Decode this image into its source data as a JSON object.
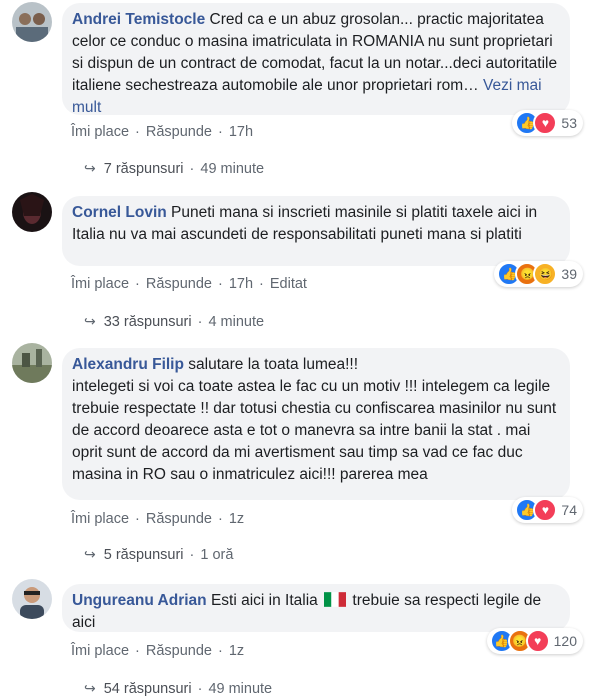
{
  "comments": [
    {
      "author": "Andrei Temistocle",
      "text": "Cred ca e un abuz grosolan... practic majoritatea celor ce conduc o masina imatriculata in ROMANIA nu sunt proprietari si dispun de un contract de comodat, facut la un notar...deci autoritatile italiene sechestreaza automobile ale unor proprietari rom…",
      "more": "Vezi mai mult",
      "like": "Îmi place",
      "reply": "Răspunde",
      "time": "17h",
      "reaction_count": "53",
      "reactions": [
        "like-icon",
        "love-icon"
      ],
      "replies": "7 răspunsuri",
      "replies_time": "49 minute"
    },
    {
      "author": "Cornel Lovin",
      "text": "Puneti mana si inscrieti masinile si platiti taxele aici in Italia nu va mai ascundeti de responsabilitati puneti mana si platiti",
      "like": "Îmi place",
      "reply": "Răspunde",
      "time": "17h",
      "edited": "Editat",
      "reaction_count": "39",
      "reactions": [
        "like-icon",
        "angry-icon",
        "haha-icon"
      ],
      "replies": "33 răspunsuri",
      "replies_time": "4 minute"
    },
    {
      "author": "Alexandru Filip",
      "text_first": "salutare la toata lumea!!!",
      "text": "intelegeti si voi ca toate astea le fac cu un motiv !!! intelegem ca legile trebuie respectate !! dar totusi chestia cu confiscarea masinilor nu sunt de accord deoarece asta e tot o manevra sa intre banii la stat . mai oprit sunt de accord da mi avertisment sau timp sa vad ce fac duc masina in RO sau o inmatriculez aici!!! parerea mea",
      "like": "Îmi place",
      "reply": "Răspunde",
      "time": "1z",
      "reaction_count": "74",
      "reactions": [
        "like-icon",
        "love-icon"
      ],
      "replies": "5 răspunsuri",
      "replies_time": "1 oră"
    },
    {
      "author": "Ungureanu Adrian",
      "text_a": "Esti aici in Italia",
      "text_b": "trebuie sa respecti legile de aici",
      "like": "Îmi place",
      "reply": "Răspunde",
      "time": "1z",
      "reaction_count": "120",
      "reactions": [
        "like-icon",
        "angry-icon",
        "love-icon"
      ],
      "replies": "54 răspunsuri",
      "replies_time": "49 minute"
    }
  ],
  "colors": {
    "author": "#385898",
    "bubble": "#f2f3f5",
    "meta": "#606770",
    "like": "#2078f4",
    "love": "#f33e58",
    "angry": "#e9710f"
  }
}
